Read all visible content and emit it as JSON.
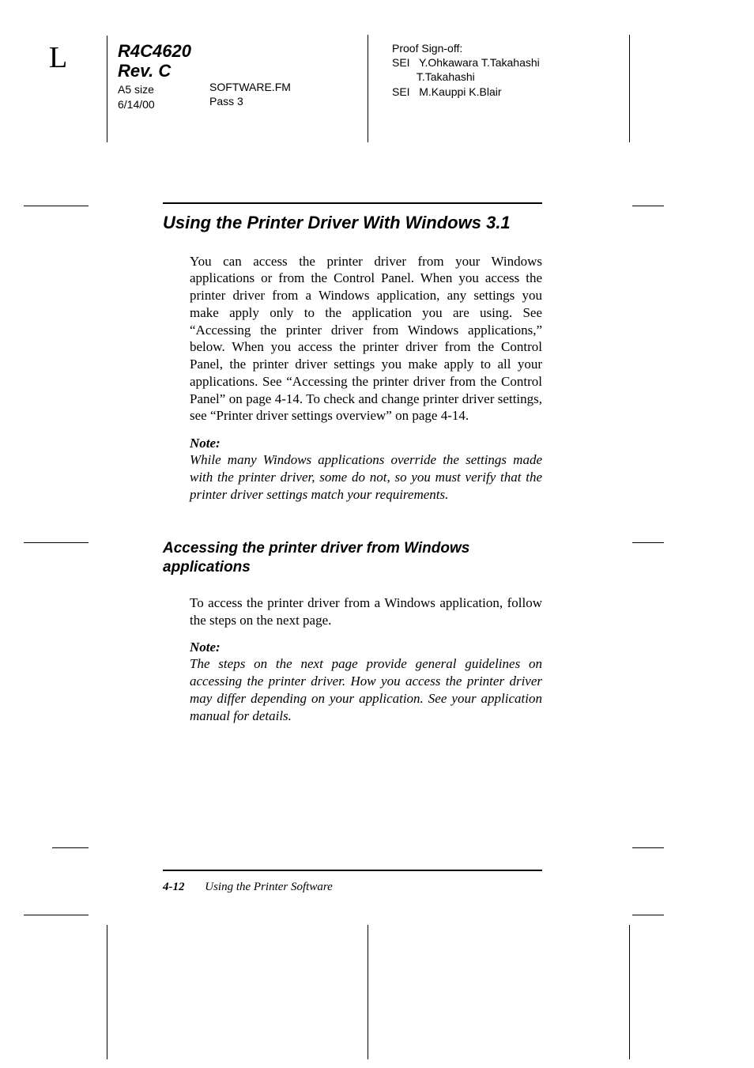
{
  "header": {
    "page_side": "L",
    "doc_code": "R4C4620",
    "revision": "Rev. C",
    "size": "A5 size",
    "date": "6/14/00",
    "filename": "SOFTWARE.FM",
    "pass": "Pass 3",
    "proof_title": "Proof Sign-off:",
    "proof_lines": [
      "SEI   Y.Ohkawara T.Takahashi",
      "        T.Takahashi",
      "SEI   M.Kauppi K.Blair"
    ]
  },
  "section": {
    "title": "Using the Printer Driver With Windows 3.1",
    "para1": "You can access the printer driver from your Windows applications or from the Control Panel. When you access the printer driver from a Windows application, any settings you make apply only to the application you are using. See “Accessing the printer driver from Windows applications,” below. When you access the printer driver from the Control Panel, the printer driver settings you make apply to all your applications. See “Accessing the printer driver from the Control Panel” on page 4-14. To check and change printer driver settings, see “Printer driver settings overview” on page 4-14.",
    "note1_label": "Note:",
    "note1": "While many Windows applications override the settings made with the printer driver, some do not, so you must verify that the printer driver settings match your requirements."
  },
  "subsection": {
    "title": "Accessing the printer driver from Windows applications",
    "para1": "To access the printer driver from a Windows application, follow the steps on the next page.",
    "note1_label": "Note:",
    "note1": "The steps on the next page provide general guidelines on accessing the printer driver. How you access the printer driver may differ depending on your application. See your application manual for details."
  },
  "footer": {
    "page_number": "4-12",
    "running_title": "Using the Printer Software"
  }
}
